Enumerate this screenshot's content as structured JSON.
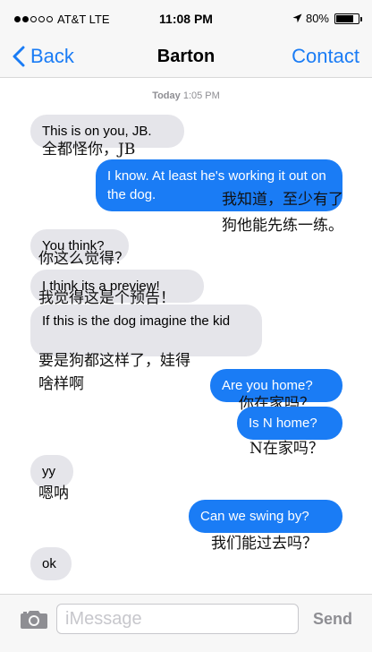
{
  "status_bar": {
    "signal_bars_filled": 2,
    "signal_bars_total": 5,
    "carrier": "AT&T LTE",
    "time": "11:08 PM",
    "battery_percent": "80%",
    "battery_level": 0.8
  },
  "nav": {
    "back_label": "Back",
    "title": "Barton",
    "contact_label": "Contact"
  },
  "conversation": {
    "timestamp_day": "Today",
    "timestamp_time": "1:05 PM",
    "messages": [
      {
        "dir": "in",
        "text": "This is on you, JB.",
        "translation": "全都怪你，JB"
      },
      {
        "dir": "out",
        "text": "I know. At least he's working it out on the dog.",
        "translation_line1": "我知道，至少有了",
        "translation_line2": "狗他能先练一练。"
      },
      {
        "dir": "in",
        "text": "You think?",
        "translation": "你这么觉得？"
      },
      {
        "dir": "in",
        "text": "I think its a preview!",
        "translation": "我觉得这是个预告！"
      },
      {
        "dir": "in",
        "text": "If this is the dog imagine the kid",
        "translation_line1": "要是狗都这样了，娃得",
        "translation_line2": "啥样啊"
      },
      {
        "dir": "out",
        "text": "Are you home?",
        "translation": "你在家吗？"
      },
      {
        "dir": "out",
        "text": "Is N home?",
        "translation": "N在家吗？"
      },
      {
        "dir": "in",
        "text": "yy",
        "translation": "嗯呐"
      },
      {
        "dir": "out",
        "text": "Can we swing by?",
        "translation": "我们能过去吗？"
      },
      {
        "dir": "in",
        "text": "ok"
      }
    ]
  },
  "input_bar": {
    "placeholder": "iMessage",
    "send_label": "Send"
  },
  "colors": {
    "accent": "#1a7cf5",
    "incoming_bubble": "#e5e5ea",
    "bar_background": "#f7f7f7"
  }
}
